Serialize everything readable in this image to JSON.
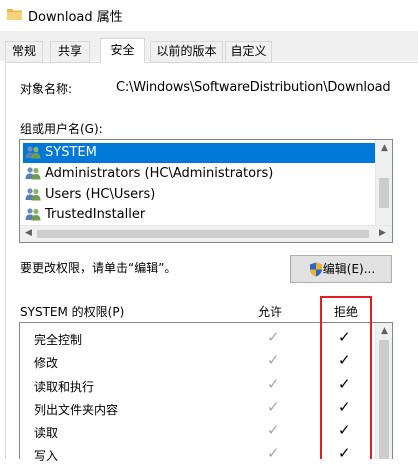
{
  "window": {
    "title": "Download 属性"
  },
  "tabs": [
    {
      "label": "常规",
      "active": false
    },
    {
      "label": "共享",
      "active": false
    },
    {
      "label": "安全",
      "active": true
    },
    {
      "label": "以前的版本",
      "active": false
    },
    {
      "label": "自定义",
      "active": false
    }
  ],
  "security": {
    "object_name_label": "对象名称:",
    "object_name_value": "C:\\Windows\\SoftwareDistribution\\Download",
    "group_label": "组或用户名(G):",
    "users": [
      {
        "name": "SYSTEM",
        "selected": true,
        "icon": "users-group-icon"
      },
      {
        "name": "Administrators (HC\\Administrators)",
        "selected": false,
        "icon": "users-group-icon"
      },
      {
        "name": "Users (HC\\Users)",
        "selected": false,
        "icon": "users-group-icon"
      },
      {
        "name": "TrustedInstaller",
        "selected": false,
        "icon": "users-group-icon"
      }
    ],
    "change_permissions_hint": "要更改权限，请单击“编辑”。",
    "edit_button_label": "编辑(E)...",
    "permissions_header": "SYSTEM 的权限(P)",
    "allow_header": "允许",
    "deny_header": "拒绝",
    "permissions": [
      {
        "name": "完全控制",
        "allow": true,
        "deny": true
      },
      {
        "name": "修改",
        "allow": true,
        "deny": true
      },
      {
        "name": "读取和执行",
        "allow": true,
        "deny": true
      },
      {
        "name": "列出文件夹内容",
        "allow": true,
        "deny": true
      },
      {
        "name": "读取",
        "allow": true,
        "deny": true
      },
      {
        "name": "写入",
        "allow": true,
        "deny": true
      }
    ]
  },
  "colors": {
    "selection": "#0078d7",
    "highlight_box": "#e02020",
    "allow_check": "#a6a6a6",
    "deny_check": "#000000"
  }
}
